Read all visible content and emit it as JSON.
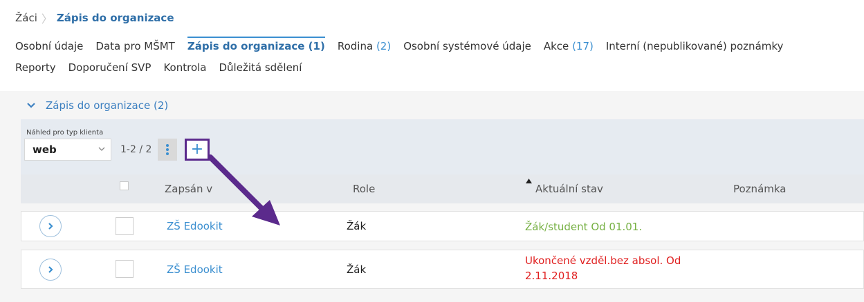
{
  "breadcrumb": {
    "root": "Žáci",
    "current": "Zápis do organizace"
  },
  "tabs_row1": [
    {
      "label": "Osobní údaje",
      "count": ""
    },
    {
      "label": "Data pro MŠMT",
      "count": ""
    },
    {
      "label": "Zápis do organizace (1)",
      "count": ""
    },
    {
      "label": "Rodina",
      "count": "(2)"
    },
    {
      "label": "Osobní systémové údaje",
      "count": ""
    },
    {
      "label": "Akce",
      "count": "(17)"
    },
    {
      "label": "Interní (nepublikované) poznámky",
      "count": ""
    }
  ],
  "tabs_row2": [
    {
      "label": "Reporty"
    },
    {
      "label": "Doporučení SVP"
    },
    {
      "label": "Kontrola"
    },
    {
      "label": "Důležitá sdělení"
    }
  ],
  "section": {
    "title": "Zápis do organizace (2)"
  },
  "toolbar": {
    "view_label": "Náhled pro typ klienta",
    "view_value": "web",
    "pager": "1-2 / 2",
    "menu_glyph": "⋮",
    "add_glyph": "+"
  },
  "table": {
    "headers": {
      "enrolled_in": "Zapsán v",
      "role": "Role",
      "state": "Aktuální stav",
      "note": "Poznámka"
    },
    "rows": [
      {
        "enrolled_in": "ZŠ Edookit",
        "role": "Žák",
        "state": "Žák/student Od 01.01.",
        "state_color": "#76b043",
        "note": ""
      },
      {
        "enrolled_in": "ZŠ Edookit",
        "role": "Žák",
        "state": "Ukončené vzděl.bez absol. Od 2.11.2018",
        "state_color": "#e02020",
        "note": ""
      }
    ]
  },
  "colors": {
    "accent": "#3b8fd0",
    "highlight": "#5b2a8c",
    "active_state": "#76b043",
    "ended_state": "#e02020"
  },
  "icons": {
    "section_toggle": "chevron-down-icon",
    "row_expand": "chevron-right-icon",
    "annotation": "arrow-icon"
  }
}
